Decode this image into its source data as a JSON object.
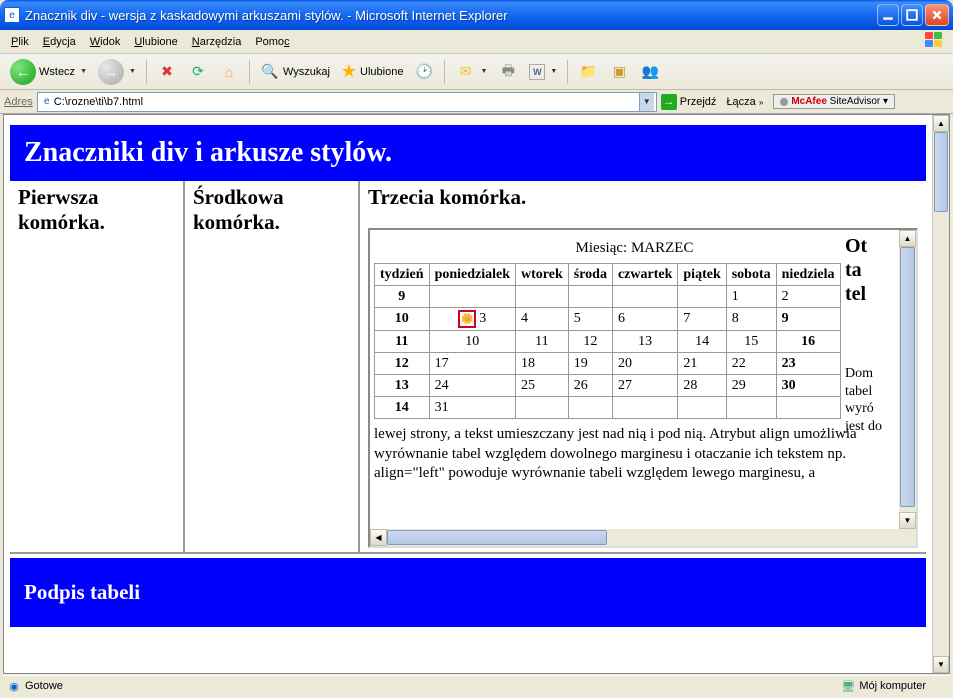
{
  "window": {
    "title": "Znacznik div - wersja z kaskadowymi arkuszami stylów. - Microsoft Internet Explorer"
  },
  "menu": {
    "items": [
      "Plik",
      "Edycja",
      "Widok",
      "Ulubione",
      "Narzędzia",
      "Pomoc"
    ]
  },
  "toolbar": {
    "back": "Wstecz",
    "search": "Wyszukaj",
    "favorites": "Ulubione"
  },
  "address": {
    "label": "Adres",
    "value": "C:\\rozne\\ti\\b7.html",
    "go": "Przejdź",
    "links": "Łącza",
    "mcafee_brand": "McAfee",
    "mcafee_prod": "SiteAdvisor"
  },
  "page": {
    "banner": "Znaczniki div i arkusze stylów.",
    "col1": "Pierwsza komórka.",
    "col2": "Środkowa komórka.",
    "col3": "Trzecia komórka.",
    "month_label": "Miesiąc:",
    "month_name": "MARZEC",
    "cal_headers": [
      "tydzień",
      "poniedzialek",
      "wtorek",
      "środa",
      "czwartek",
      "piątek",
      "sobota",
      "niedziela"
    ],
    "weeks": [
      {
        "wk": "9",
        "cells": [
          "",
          "",
          "",
          "",
          "",
          "1",
          "2"
        ]
      },
      {
        "wk": "10",
        "cells": [
          "3",
          "4",
          "5",
          "6",
          "7",
          "8",
          "9"
        ],
        "flower": true,
        "sunday_bold": true
      },
      {
        "wk": "11",
        "cells": [
          "10",
          "11",
          "12",
          "13",
          "14",
          "15",
          "16"
        ],
        "centered": true,
        "sunday_bold": true,
        "wk_left": true
      },
      {
        "wk": "12",
        "cells": [
          "17",
          "18",
          "19",
          "20",
          "21",
          "22",
          "23"
        ],
        "sunday_bold": true
      },
      {
        "wk": "13",
        "cells": [
          "24",
          "25",
          "26",
          "27",
          "28",
          "29",
          "30"
        ],
        "sunday_bold": true
      },
      {
        "wk": "14",
        "cells": [
          "31",
          "",
          "",
          "",
          "",
          "",
          ""
        ]
      }
    ],
    "side_title_1": "Ot",
    "side_title_2": "ta",
    "side_title_3": "tel",
    "side_p": "Dom tabel wyró jest do",
    "body_p": "lewej strony, a tekst umieszczany jest nad nią i pod nią. Atrybut align umożliwia wyrównanie tabel względem dowolnego marginesu i otaczanie ich tekstem np. align=\"left\" powoduje wyrównanie tabeli względem lewego marginesu, a",
    "footer": "Podpis tabeli"
  },
  "status": {
    "left": "Gotowe",
    "right": "Mój komputer"
  }
}
